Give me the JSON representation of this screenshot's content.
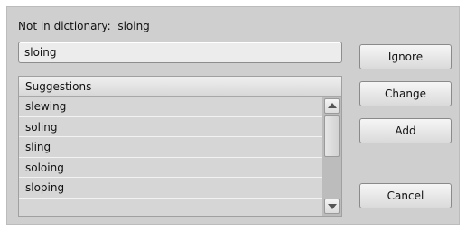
{
  "header": {
    "label": "Not in dictionary:  sloing"
  },
  "word_input": {
    "value": "sloing"
  },
  "suggestions": {
    "column_header": "Suggestions",
    "items": [
      "slewing",
      "soling",
      "sling",
      "soloing",
      "sloping"
    ]
  },
  "buttons": {
    "ignore": "Ignore",
    "change": "Change",
    "add": "Add",
    "cancel": "Cancel"
  },
  "scrollbar": {
    "up_icon": "arrow-up-icon",
    "down_icon": "arrow-down-icon"
  },
  "colors": {
    "dialog_bg": "#cfcfcf",
    "list_bg": "#d6d6d6"
  }
}
